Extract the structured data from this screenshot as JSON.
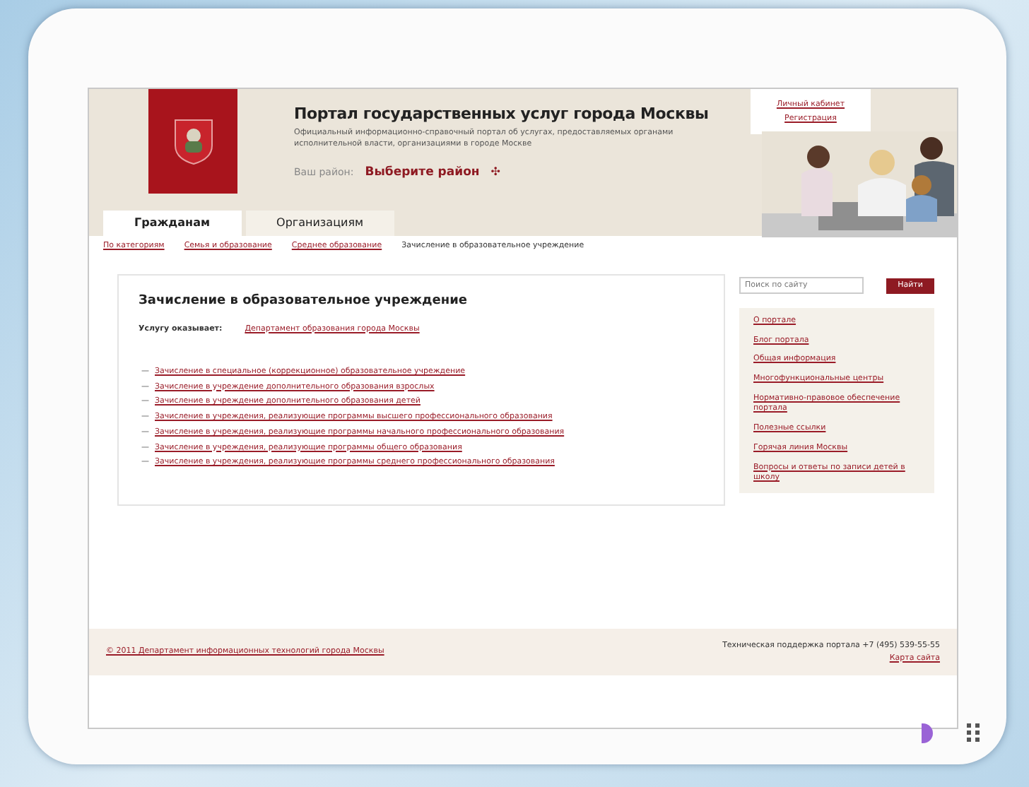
{
  "header": {
    "title": "Портал государственных услуг города Москвы",
    "subtitle": "Официальный информационно-справочный портал об услугах, предоставляемых органами исполнительной власти, организациями в городе Москве",
    "district_label": "Ваш район:",
    "district_link": "Выберите район",
    "district_icon": "✣",
    "account_links": [
      "Личный кабинет",
      "Регистрация"
    ]
  },
  "tabs": [
    {
      "label": "Гражданам",
      "selected": true
    },
    {
      "label": "Организациям",
      "selected": false
    }
  ],
  "breadcrumbs": [
    {
      "label": "По категориям",
      "kind": "link"
    },
    {
      "label": "Семья и образование",
      "kind": "link"
    },
    {
      "label": "Среднее образование",
      "kind": "link"
    },
    {
      "label": "Зачисление в образовательное учреждение",
      "kind": "current"
    }
  ],
  "main": {
    "heading": "Зачисление в образовательное учреждение",
    "provider_label": "Услугу оказывает:",
    "provider_link": "Департамент образования города Москвы",
    "bullet": "—",
    "links": [
      "Зачисление в специальное (коррекционное) образовательное учреждение",
      "Зачисление в учреждение дополнительного образования взрослых",
      "Зачисление в учреждение дополнительного образования детей",
      "Зачисление в учреждения, реализующие программы высшего профессионального образования",
      "Зачисление в учреждения, реализующие программы начального профессионального образования",
      "Зачисление в учреждения, реализующие программы общего образования",
      "Зачисление в учреждения, реализующие программы среднего профессионального образования"
    ]
  },
  "sidebar": {
    "search_placeholder": "Поиск по сайту",
    "search_button": "Найти",
    "links": [
      "О портале",
      "Блог портала",
      "Общая информация",
      "Многофункциональные центры",
      "Нормативно-правовое обеспечение портала",
      "Полезные ссылки",
      "Горячая линия Москвы",
      "Вопросы и ответы по записи детей в школу"
    ]
  },
  "footer": {
    "copyright": "© 2011 Департамент информационных технологий города Москвы",
    "support": "Техническая поддержка портала +7 (495) 539-55-55",
    "sitemap": "Карта сайта"
  }
}
